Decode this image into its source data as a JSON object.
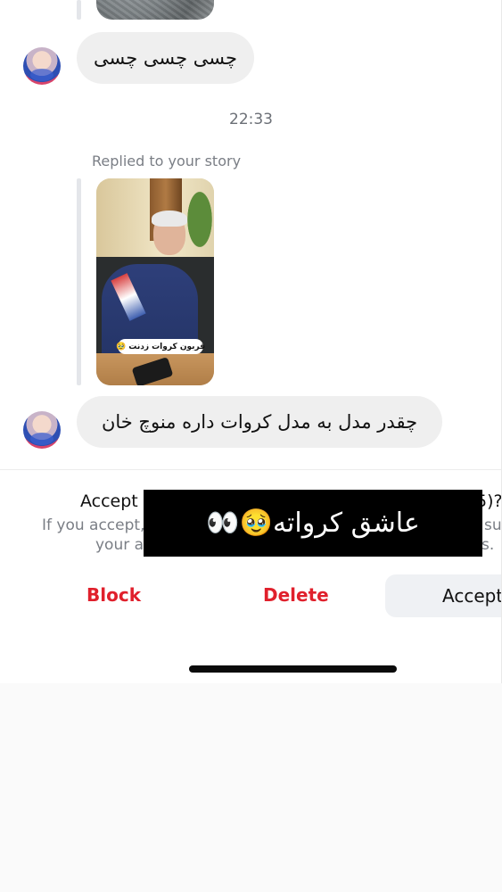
{
  "messages": [
    {
      "text": "چسی چسی چسی"
    },
    {
      "text": "چقدر  مدل به مدل کروات داره منوچ خان"
    }
  ],
  "timestamp": "22:33",
  "replied_label": "Replied to your story",
  "story_sticker": "قربون کروات زدنت 🥹",
  "request": {
    "title_start": "Accept",
    "title_end": "5)?",
    "desc_line1_start": "If you accept,",
    "desc_line1_end": "su",
    "desc_line2_start": "your ac",
    "desc_line2_end": "s."
  },
  "overlay_text": "عاشق کرواته🥹👀",
  "actions": {
    "block": "Block",
    "delete": "Delete",
    "accept": "Accept"
  }
}
